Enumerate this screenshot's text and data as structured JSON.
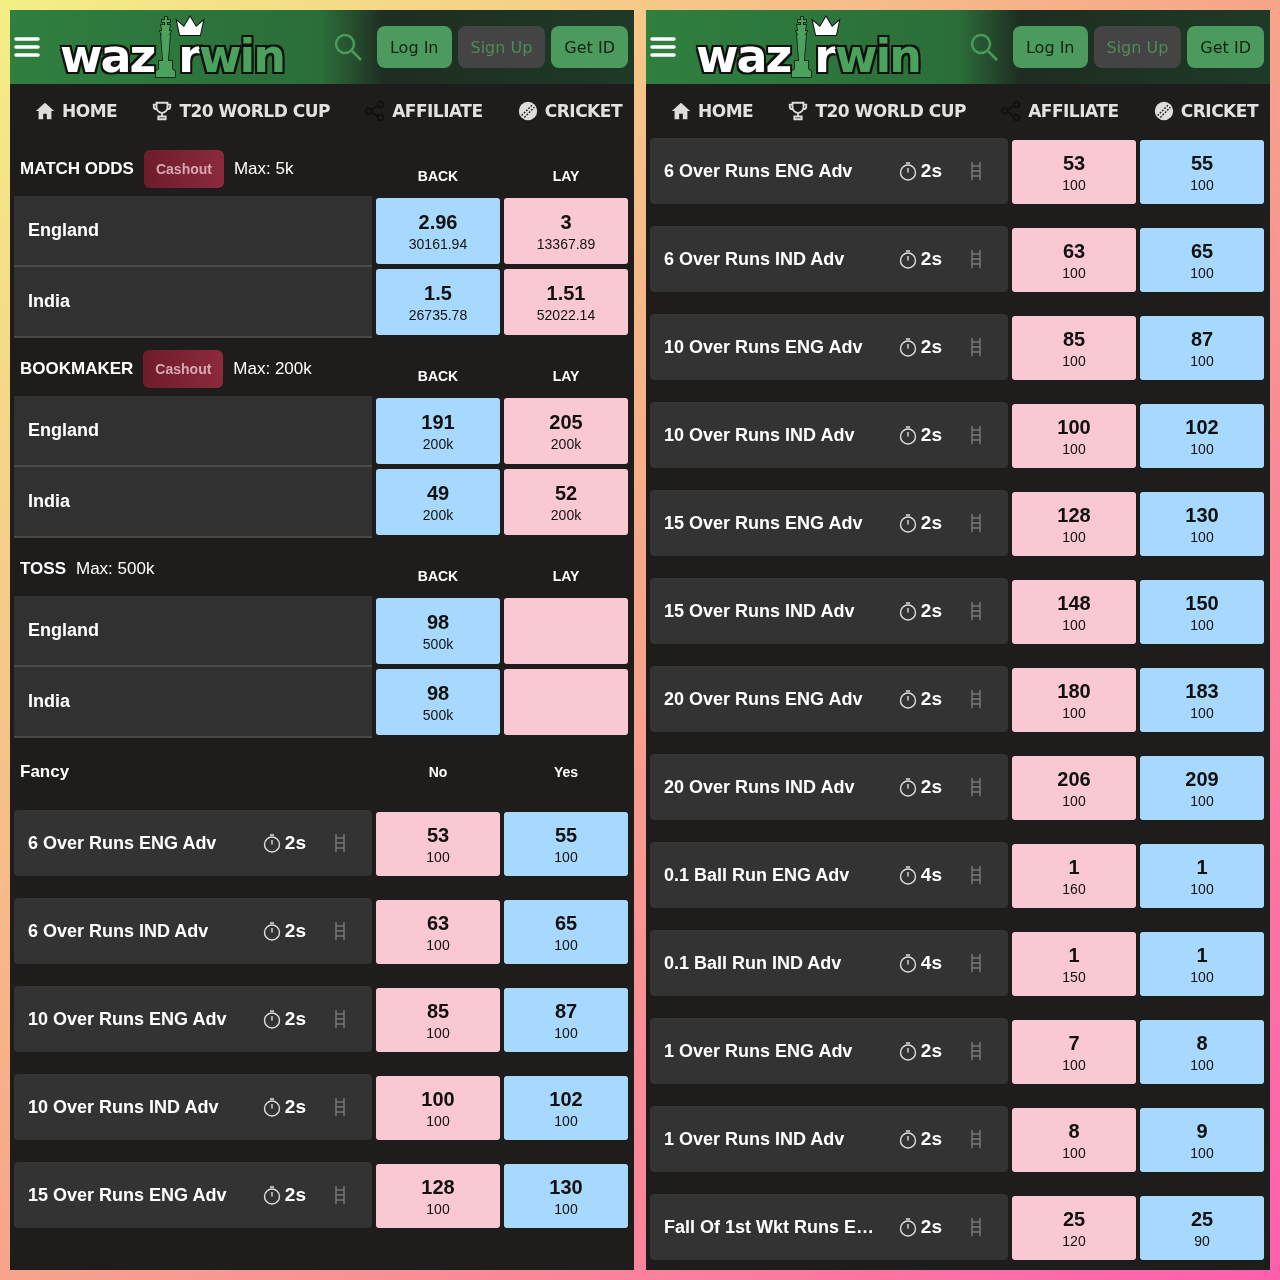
{
  "panels": [
    {
      "header": {
        "logo": [
          {
            "text": "waz",
            "accent": false
          },
          {
            "text": "r",
            "accent": false
          },
          {
            "text": "win",
            "accent": true
          }
        ],
        "buttons": [
          {
            "label": "Log In",
            "disabled": false
          },
          {
            "label": "Sign Up",
            "disabled": true
          },
          {
            "label": "Get ID",
            "disabled": false
          }
        ]
      },
      "nav": [
        {
          "label": "HOME",
          "kind": "home"
        },
        {
          "label": "T20 WORLD CUP",
          "kind": "trophy"
        },
        {
          "label": "AFFILIATE",
          "kind": "share"
        },
        {
          "label": "CRICKET",
          "kind": "ball"
        }
      ],
      "sections": [
        {
          "kind": "market",
          "title": "MATCH ODDS",
          "cashout": "Cashout",
          "max": "Max: 5k",
          "columns": [
            "BACK",
            "LAY"
          ],
          "rows": [
            {
              "name": "England",
              "cells": [
                {
                  "kind": "back",
                  "price": "2.96",
                  "size": "30161.94"
                },
                {
                  "kind": "lay",
                  "price": "3",
                  "size": "13367.89"
                }
              ]
            },
            {
              "name": "India",
              "cells": [
                {
                  "kind": "back",
                  "price": "1.5",
                  "size": "26735.78"
                },
                {
                  "kind": "lay",
                  "price": "1.51",
                  "size": "52022.14"
                }
              ]
            }
          ]
        },
        {
          "kind": "market",
          "title": "BOOKMAKER",
          "cashout": "Cashout",
          "max": "Max: 200k",
          "columns": [
            "BACK",
            "LAY"
          ],
          "rows": [
            {
              "name": "England",
              "cells": [
                {
                  "kind": "back",
                  "price": "191",
                  "size": "200k"
                },
                {
                  "kind": "lay",
                  "price": "205",
                  "size": "200k"
                }
              ]
            },
            {
              "name": "India",
              "cells": [
                {
                  "kind": "back",
                  "price": "49",
                  "size": "200k"
                },
                {
                  "kind": "lay",
                  "price": "52",
                  "size": "200k"
                }
              ]
            }
          ]
        },
        {
          "kind": "market",
          "title": "TOSS",
          "max": "Max: 500k",
          "columns": [
            "BACK",
            "LAY"
          ],
          "rows": [
            {
              "name": "England",
              "cells": [
                {
                  "kind": "back",
                  "price": "98",
                  "size": "500k"
                },
                {
                  "kind": "lay"
                }
              ]
            },
            {
              "name": "India",
              "cells": [
                {
                  "kind": "back",
                  "price": "98",
                  "size": "500k"
                },
                {
                  "kind": "lay"
                }
              ]
            }
          ]
        },
        {
          "kind": "fancy",
          "title": "Fancy",
          "columns": [
            "No",
            "Yes"
          ],
          "rows": [
            {
              "name": "6 Over Runs ENG Adv",
              "timer": "2s",
              "cells": [
                {
                  "kind": "no",
                  "price": "53",
                  "size": "100"
                },
                {
                  "kind": "yes",
                  "price": "55",
                  "size": "100"
                }
              ]
            },
            {
              "name": "6 Over Runs IND Adv",
              "timer": "2s",
              "cells": [
                {
                  "kind": "no",
                  "price": "63",
                  "size": "100"
                },
                {
                  "kind": "yes",
                  "price": "65",
                  "size": "100"
                }
              ]
            },
            {
              "name": "10 Over Runs ENG Adv",
              "timer": "2s",
              "cells": [
                {
                  "kind": "no",
                  "price": "85",
                  "size": "100"
                },
                {
                  "kind": "yes",
                  "price": "87",
                  "size": "100"
                }
              ]
            },
            {
              "name": "10 Over Runs IND Adv",
              "timer": "2s",
              "cells": [
                {
                  "kind": "no",
                  "price": "100",
                  "size": "100"
                },
                {
                  "kind": "yes",
                  "price": "102",
                  "size": "100"
                }
              ]
            },
            {
              "name": "15 Over Runs ENG Adv",
              "timer": "2s",
              "cells": [
                {
                  "kind": "no",
                  "price": "128",
                  "size": "100"
                },
                {
                  "kind": "yes",
                  "price": "130",
                  "size": "100"
                }
              ]
            }
          ]
        }
      ]
    },
    {
      "header": {
        "logo": [
          {
            "text": "waz",
            "accent": false
          },
          {
            "text": "r",
            "accent": false
          },
          {
            "text": "win",
            "accent": true
          }
        ],
        "buttons": [
          {
            "label": "Log In",
            "disabled": false
          },
          {
            "label": "Sign Up",
            "disabled": true
          },
          {
            "label": "Get ID",
            "disabled": false
          }
        ]
      },
      "nav": [
        {
          "label": "HOME",
          "kind": "home"
        },
        {
          "label": "T20 WORLD CUP",
          "kind": "trophy"
        },
        {
          "label": "AFFILIATE",
          "kind": "share"
        },
        {
          "label": "CRICKET",
          "kind": "ball"
        }
      ],
      "sections": [
        {
          "kind": "fancy",
          "rows": [
            {
              "name": "6 Over Runs ENG Adv",
              "timer": "2s",
              "cells": [
                {
                  "kind": "no",
                  "price": "53",
                  "size": "100"
                },
                {
                  "kind": "yes",
                  "price": "55",
                  "size": "100"
                }
              ]
            },
            {
              "name": "6 Over Runs IND Adv",
              "timer": "2s",
              "cells": [
                {
                  "kind": "no",
                  "price": "63",
                  "size": "100"
                },
                {
                  "kind": "yes",
                  "price": "65",
                  "size": "100"
                }
              ]
            },
            {
              "name": "10 Over Runs ENG Adv",
              "timer": "2s",
              "cells": [
                {
                  "kind": "no",
                  "price": "85",
                  "size": "100"
                },
                {
                  "kind": "yes",
                  "price": "87",
                  "size": "100"
                }
              ]
            },
            {
              "name": "10 Over Runs IND Adv",
              "timer": "2s",
              "cells": [
                {
                  "kind": "no",
                  "price": "100",
                  "size": "100"
                },
                {
                  "kind": "yes",
                  "price": "102",
                  "size": "100"
                }
              ]
            },
            {
              "name": "15 Over Runs ENG Adv",
              "timer": "2s",
              "cells": [
                {
                  "kind": "no",
                  "price": "128",
                  "size": "100"
                },
                {
                  "kind": "yes",
                  "price": "130",
                  "size": "100"
                }
              ]
            },
            {
              "name": "15 Over Runs IND Adv",
              "timer": "2s",
              "cells": [
                {
                  "kind": "no",
                  "price": "148",
                  "size": "100"
                },
                {
                  "kind": "yes",
                  "price": "150",
                  "size": "100"
                }
              ]
            },
            {
              "name": "20 Over Runs ENG Adv",
              "timer": "2s",
              "cells": [
                {
                  "kind": "no",
                  "price": "180",
                  "size": "100"
                },
                {
                  "kind": "yes",
                  "price": "183",
                  "size": "100"
                }
              ]
            },
            {
              "name": "20 Over Runs IND Adv",
              "timer": "2s",
              "cells": [
                {
                  "kind": "no",
                  "price": "206",
                  "size": "100"
                },
                {
                  "kind": "yes",
                  "price": "209",
                  "size": "100"
                }
              ]
            },
            {
              "name": "0.1 Ball Run ENG Adv",
              "timer": "4s",
              "cells": [
                {
                  "kind": "no",
                  "price": "1",
                  "size": "160"
                },
                {
                  "kind": "yes",
                  "price": "1",
                  "size": "100"
                }
              ]
            },
            {
              "name": "0.1 Ball Run IND Adv",
              "timer": "4s",
              "cells": [
                {
                  "kind": "no",
                  "price": "1",
                  "size": "150"
                },
                {
                  "kind": "yes",
                  "price": "1",
                  "size": "100"
                }
              ]
            },
            {
              "name": "1 Over Runs ENG Adv",
              "timer": "2s",
              "cells": [
                {
                  "kind": "no",
                  "price": "7",
                  "size": "100"
                },
                {
                  "kind": "yes",
                  "price": "8",
                  "size": "100"
                }
              ]
            },
            {
              "name": "1 Over Runs IND Adv",
              "timer": "2s",
              "cells": [
                {
                  "kind": "no",
                  "price": "8",
                  "size": "100"
                },
                {
                  "kind": "yes",
                  "price": "9",
                  "size": "100"
                }
              ]
            },
            {
              "name": "Fall Of 1st Wkt Runs E…",
              "timer": "2s",
              "cells": [
                {
                  "kind": "no",
                  "price": "25",
                  "size": "120"
                },
                {
                  "kind": "yes",
                  "price": "25",
                  "size": "90"
                }
              ]
            }
          ]
        }
      ]
    }
  ]
}
